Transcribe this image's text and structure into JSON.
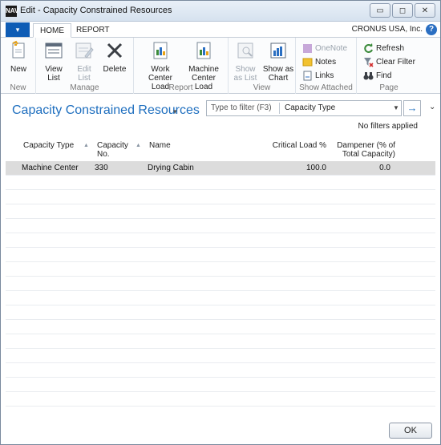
{
  "window": {
    "title": "Edit - Capacity Constrained Resources",
    "logo_text": "NAV",
    "minimize_glyph": "▭",
    "maximize_glyph": "◻",
    "close_glyph": "✕"
  },
  "ribbon_tabs": {
    "file_glyph": "▾",
    "tabs": [
      "HOME",
      "REPORT"
    ],
    "active_tab": "HOME",
    "company": "CRONUS USA, Inc.",
    "help_glyph": "?"
  },
  "ribbon": {
    "groups": [
      {
        "label": "New",
        "buttons": [
          "New"
        ]
      },
      {
        "label": "Manage",
        "buttons": [
          "View List",
          "Edit List",
          "Delete"
        ]
      },
      {
        "label": "Report",
        "buttons": [
          "Work Center Load",
          "Machine Center Load"
        ]
      },
      {
        "label": "View",
        "buttons": [
          "Show as List",
          "Show as Chart"
        ]
      },
      {
        "label": "Show Attached",
        "buttons": [
          "OneNote",
          "Notes",
          "Links"
        ]
      },
      {
        "label": "Page",
        "buttons": [
          "Refresh",
          "Clear Filter",
          "Find"
        ]
      }
    ],
    "new_label": "New",
    "view_list_label_1": "View",
    "view_list_label_2": "List",
    "edit_list_label_1": "Edit",
    "edit_list_label_2": "List",
    "delete_label": "Delete",
    "work_center_label_1": "Work",
    "work_center_label_2": "Center Load",
    "machine_center_label_1": "Machine",
    "machine_center_label_2": "Center Load",
    "show_list_label_1": "Show",
    "show_list_label_2": "as List",
    "show_chart_label_1": "Show as",
    "show_chart_label_2": "Chart",
    "onenote_label": "OneNote",
    "notes_label": "Notes",
    "links_label": "Links",
    "refresh_label": "Refresh",
    "clear_filter_label": "Clear Filter",
    "find_label": "Find",
    "group_new": "New",
    "group_manage": "Manage",
    "group_report": "Report",
    "group_view": "View",
    "group_show_attached": "Show Attached",
    "group_page": "Page"
  },
  "page": {
    "title": "Capacity Constrained Resources",
    "title_caret": "▾",
    "filter_placeholder": "Type to filter (F3)",
    "filter_field": "Capacity Type",
    "filter_dropdown_glyph": "▼",
    "go_glyph": "→",
    "collapse_glyph": "⌄",
    "filter_status": "No filters applied"
  },
  "grid": {
    "columns": {
      "capacity_type": "Capacity Type",
      "capacity_no_1": "Capacity",
      "capacity_no_2": "No.",
      "name": "Name",
      "critical_load": "Critical Load %",
      "dampener_1": "Dampener (% of",
      "dampener_2": "Total Capacity)"
    },
    "sort_glyph": "▲",
    "rows": [
      {
        "capacity_type": "Machine Center",
        "capacity_no": "330",
        "name": "Drying Cabin",
        "critical_load": "100.0",
        "dampener": "0.0"
      }
    ]
  },
  "footer": {
    "ok_label": "OK"
  },
  "colors": {
    "accent": "#1f6fbf",
    "file_menu": "#0e5cb5",
    "selected_row": "#dcdcdc"
  }
}
